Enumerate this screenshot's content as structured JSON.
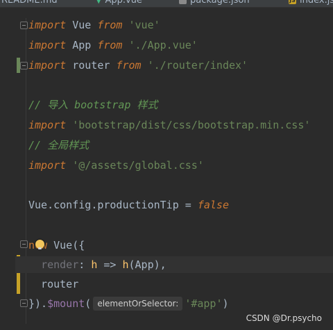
{
  "tabs": [
    {
      "label": "README.md"
    },
    {
      "label": "App.vue"
    },
    {
      "label": "package.json"
    },
    {
      "label": "index.js"
    }
  ],
  "editor": {
    "lines": [
      {
        "tokens": [
          "import",
          " Vue ",
          "from",
          " ",
          "'vue'"
        ]
      },
      {
        "tokens": [
          "import",
          " App ",
          "from",
          " ",
          "'./App.vue'"
        ]
      },
      {
        "tokens": [
          "import",
          " router ",
          "from",
          " ",
          "'./router/index'"
        ]
      },
      {
        "tokens": [
          "// 导入 bootstrap 样式"
        ]
      },
      {
        "tokens": [
          "import",
          " ",
          "'bootstrap/dist/css/bootstrap.min.css'"
        ]
      },
      {
        "tokens": [
          "// 全局样式"
        ]
      },
      {
        "tokens": [
          "import",
          " ",
          "'@/assets/global.css'"
        ]
      },
      {
        "tokens": [
          "Vue",
          ".",
          "config",
          ".",
          "productionTip",
          " = ",
          "false"
        ]
      },
      {
        "tokens": [
          "new",
          " Vue({"
        ]
      },
      {
        "tokens": [
          "  ",
          "render",
          ": ",
          "h",
          " => ",
          "h",
          "(App),"
        ]
      },
      {
        "tokens": [
          "  router"
        ]
      },
      {
        "tokens": [
          "}).",
          "$mount",
          "(",
          "'#app'",
          ")"
        ]
      }
    ],
    "param_hint": "elementOrSelector:"
  },
  "watermark": "CSDN @Dr.psycho",
  "colors": {
    "background": "#2b2b2b",
    "keyword": "#cc7832",
    "string": "#6a8759",
    "comment": "#629755",
    "property": "#9876aa",
    "function": "#ffc66d",
    "change_marker": "#c7a227"
  }
}
